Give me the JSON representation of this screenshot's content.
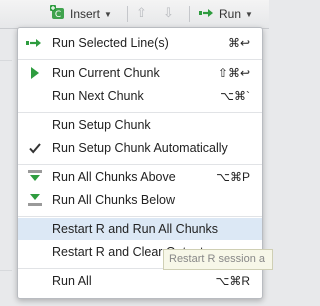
{
  "toolbar": {
    "insert_label": "Insert",
    "run_label": "Run",
    "insert_icon": "insert-chunk-icon",
    "run_icon": "run-arrow-icon",
    "up_icon": "arrow-up-icon",
    "down_icon": "arrow-down-icon"
  },
  "menu": {
    "items": [
      {
        "label": "Run Selected Line(s)",
        "shortcut": "⌘↩",
        "icon": "run-selected-arrow-icon"
      },
      {
        "label": "Run Current Chunk",
        "shortcut": "⇧⌘↩",
        "icon": "play-triangle-icon"
      },
      {
        "label": "Run Next Chunk",
        "shortcut": "⌥⌘`",
        "icon": ""
      },
      {
        "label": "Run Setup Chunk",
        "shortcut": "",
        "icon": ""
      },
      {
        "label": "Run Setup Chunk Automatically",
        "shortcut": "",
        "icon": "checkmark-icon"
      },
      {
        "label": "Run All Chunks Above",
        "shortcut": "⌥⌘P",
        "icon": "run-above-icon"
      },
      {
        "label": "Run All Chunks Below",
        "shortcut": "",
        "icon": "run-below-icon"
      },
      {
        "label": "Restart R and Run All Chunks",
        "shortcut": "",
        "icon": ""
      },
      {
        "label": "Restart R and Clear Output",
        "shortcut": "",
        "icon": ""
      },
      {
        "label": "Run All",
        "shortcut": "⌥⌘R",
        "icon": ""
      }
    ]
  },
  "tooltip": {
    "text": "Restart R session a"
  },
  "colors": {
    "accent_green": "#2e9c3f",
    "selected_row": "#dce8f5"
  }
}
